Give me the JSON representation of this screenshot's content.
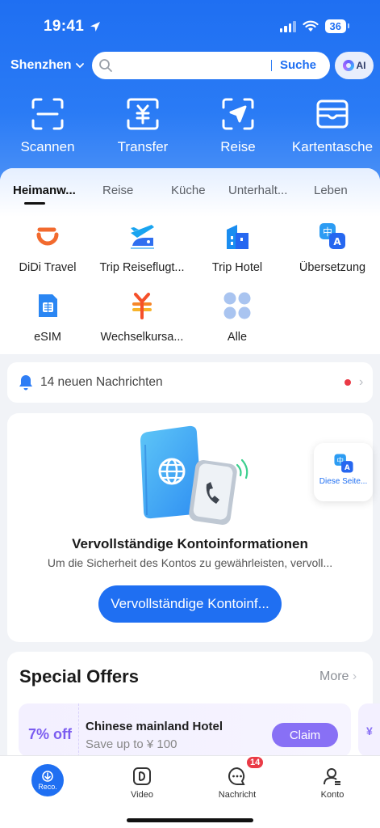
{
  "status_bar": {
    "time": "19:41",
    "battery": "36"
  },
  "header": {
    "city": "Shenzhen",
    "search": {
      "placeholder": "",
      "button": "Suche"
    },
    "ai_label": "AI"
  },
  "quick_actions": [
    {
      "label": "Scannen",
      "icon": "scan-icon"
    },
    {
      "label": "Transfer",
      "icon": "yuan-transfer-icon"
    },
    {
      "label": "Reise",
      "icon": "travel-arrow-icon"
    },
    {
      "label": "Kartentasche",
      "icon": "wallet-icon"
    }
  ],
  "categories": [
    {
      "label": "Heimanw...",
      "active": true
    },
    {
      "label": "Reise"
    },
    {
      "label": "Küche"
    },
    {
      "label": "Unterhalt..."
    },
    {
      "label": "Leben"
    }
  ],
  "apps": [
    {
      "label": "DiDi Travel",
      "icon": "didi-icon"
    },
    {
      "label": "Trip Reiseflugt...",
      "icon": "flight-train-icon"
    },
    {
      "label": "Trip Hotel",
      "icon": "hotel-icon"
    },
    {
      "label": "Übersetzung",
      "icon": "translate-icon"
    },
    {
      "label": "eSIM",
      "icon": "esim-icon"
    },
    {
      "label": "Wechselkursa...",
      "icon": "exchange-icon"
    },
    {
      "label": "Alle",
      "icon": "all-apps-icon"
    }
  ],
  "notice": {
    "text": "14 neuen Nachrichten"
  },
  "account_card": {
    "title": "Vervollständige Kontoinformationen",
    "subtitle": "Um die Sicherheit des Kontos zu gewährleisten, vervoll...",
    "cta": "Vervollständige Kontoinf..."
  },
  "translate_float": {
    "label": "Diese Seite..."
  },
  "offers": {
    "heading": "Special Offers",
    "more": "More",
    "items": [
      {
        "discount": "7% off",
        "name": "Chinese mainland Hotel",
        "desc": "Save up to ¥ 100",
        "button": "Claim"
      }
    ]
  },
  "tabbar": {
    "items": [
      {
        "label": "Reco.",
        "active": true
      },
      {
        "label": "Video"
      },
      {
        "label": "Nachricht",
        "badge": "14"
      },
      {
        "label": "Konto"
      }
    ]
  },
  "colors": {
    "brand": "#1f6ff2",
    "offer_purple": "#8870f5",
    "badge_red": "#ea3a46"
  }
}
